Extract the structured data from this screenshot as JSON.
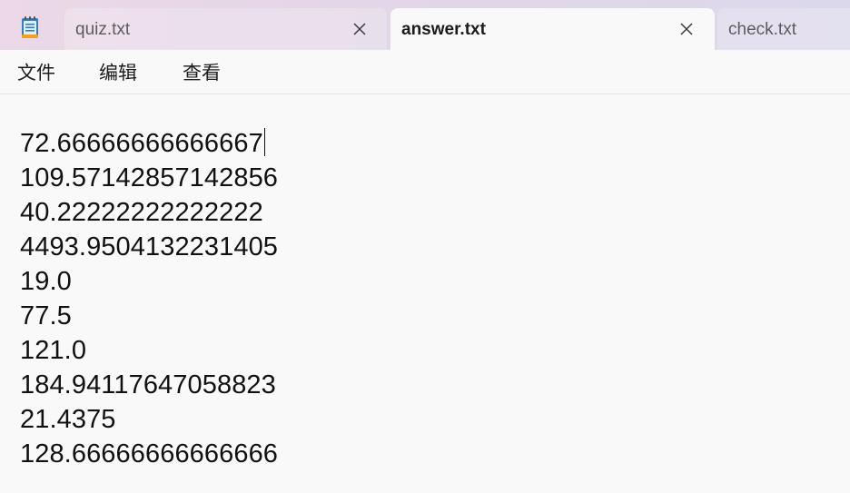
{
  "tabs": [
    {
      "label": "quiz.txt",
      "active": false,
      "close_icon": "close-icon"
    },
    {
      "label": "answer.txt",
      "active": true,
      "close_icon": "close-icon"
    },
    {
      "label": "check.txt",
      "active": false
    }
  ],
  "app_icon": "notepad-icon",
  "menu": {
    "file": "文件",
    "edit": "编辑",
    "view": "查看"
  },
  "editor": {
    "lines": [
      "72.66666666666667",
      "109.57142857142856",
      "40.22222222222222",
      "4493.9504132231405",
      "19.0",
      "77.5",
      "121.0",
      "184.94117647058823",
      "21.4375",
      "128.66666666666666"
    ]
  },
  "colors": {
    "titlebar": "#e4d6e8",
    "active_tab": "#f9f9f9",
    "editor_bg": "#f9f9f9",
    "text": "#111111",
    "icon_blue": "#2f7fc1"
  }
}
